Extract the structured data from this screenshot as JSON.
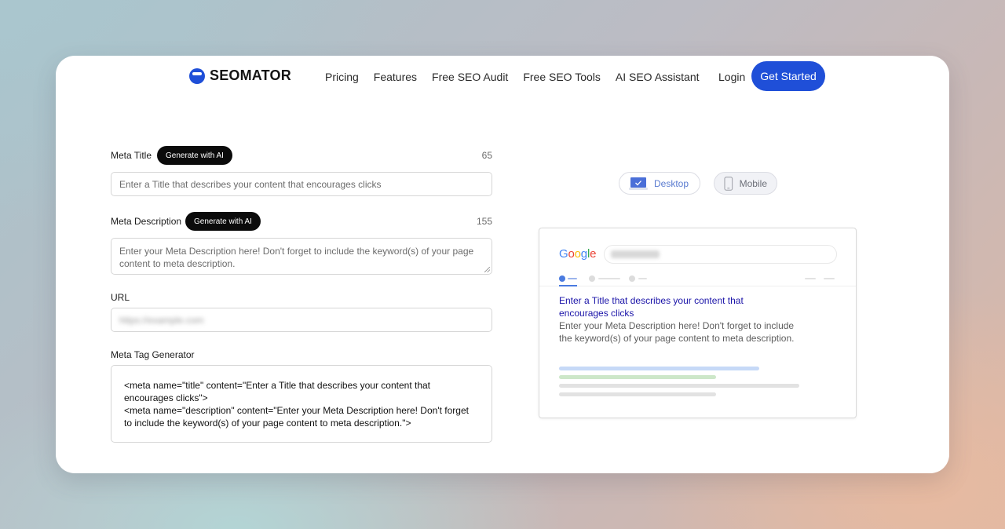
{
  "nav": {
    "brand": "SEOMATOR",
    "links": [
      "Pricing",
      "Features",
      "Free SEO Audit",
      "Free SEO Tools",
      "AI SEO Assistant"
    ],
    "login": "Login",
    "cta": "Get Started"
  },
  "form": {
    "meta_title": {
      "label": "Meta Title",
      "ai_button": "Generate with AI",
      "count": "65",
      "placeholder": "Enter a Title that describes your content that encourages clicks"
    },
    "meta_description": {
      "label": "Meta Description",
      "ai_button": "Generate with AI",
      "count": "155",
      "placeholder": "Enter your Meta Description here! Don't forget to include the keyword(s) of your page content to meta description."
    },
    "url": {
      "label": "URL",
      "value": "https://example.com"
    },
    "generator": {
      "label": "Meta Tag Generator",
      "line1": "<meta name=\"title\" content=\"Enter a Title that describes your content that encourages clicks\">",
      "line2": "<meta name=\"description\" content=\"Enter your Meta Description here! Don't forget to include the keyword(s) of your page content to meta description.\">"
    }
  },
  "preview": {
    "toggle_desktop": "Desktop",
    "toggle_mobile": "Mobile",
    "active_toggle": "Desktop",
    "search_brand": "Google",
    "result_title": "Enter a Title that describes your content that encourages clicks",
    "result_description": "Enter your Meta Description here! Don't forget to include the keyword(s) of your page content to meta description."
  },
  "colors": {
    "accent": "#1f4fd8",
    "result_title": "#1a13a8",
    "result_text": "#5e5e5e",
    "skeleton_blue": "#c6d9f7",
    "skeleton_green": "#cde7c9",
    "skeleton_gray": "#e2e2e2"
  },
  "icons": {
    "brand": "seomator-logo-icon",
    "desktop": "laptop-icon",
    "mobile": "phone-icon"
  }
}
